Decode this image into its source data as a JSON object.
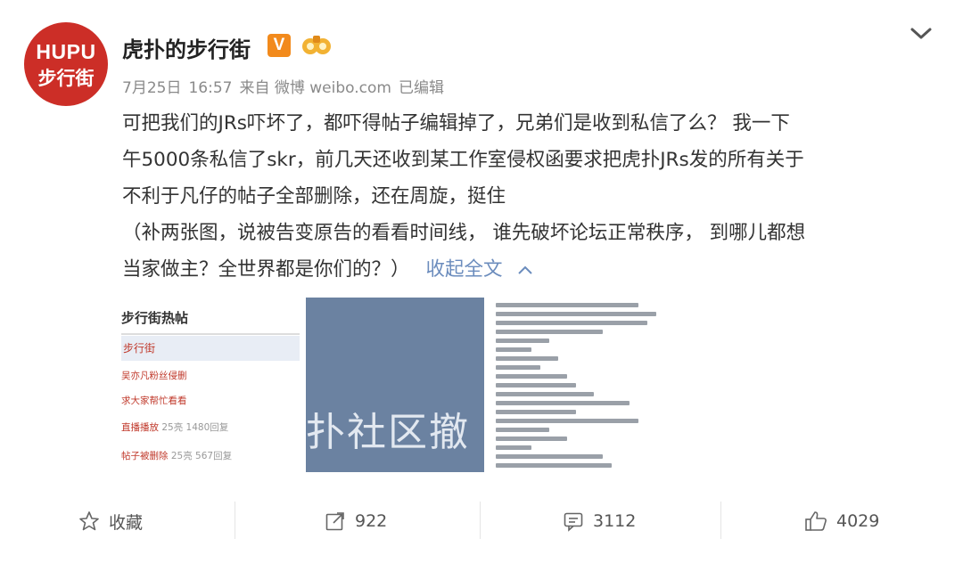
{
  "account": {
    "avatar_line1": "HUPU",
    "avatar_line2": "步行街",
    "name": "虎扑的步行街",
    "verified_badge": "V",
    "medal_icon": "medal-icon"
  },
  "meta": {
    "date": "7月25日",
    "time": "16:57",
    "source": "来自 微博 weibo.com",
    "edited": "已编辑"
  },
  "post": {
    "lines": [
      "可把我们的JRs吓坏了，都吓得帖子编辑掉了，兄弟们是收到私信了么？ 我一下",
      "午5000条私信了skr，前几天还收到某工作室侵权函要求把虎扑JRs发的所有关于",
      "不利于凡仔的帖子全部删除，还在周旋，挺住",
      "（补两张图，说被告变原告的看看时间线， 谁先破坏论坛正常秩序， 到哪儿都想",
      "当家做主？全世界都是你们的？）"
    ],
    "collapse_label": "收起全文"
  },
  "images": {
    "hot_posts": {
      "title": "步行街热帖",
      "section": "步行街",
      "rows": [
        {
          "text": "吴亦凡粉丝侵删"
        },
        {
          "text": "求大家帮忙看看"
        },
        {
          "text": "直播播放",
          "meta": "25亮 1480回复"
        },
        {
          "text": "帖子被删除",
          "meta": "25亮 567回复"
        }
      ]
    },
    "banner_text": "扑社区撤"
  },
  "actions": {
    "favorite_label": "收藏",
    "repost_count": "922",
    "comment_count": "3112",
    "like_count": "4029"
  },
  "colors": {
    "brand_red": "#cc2e27",
    "verified_orange": "#f28a1c",
    "link_blue": "#6b8cbd"
  }
}
